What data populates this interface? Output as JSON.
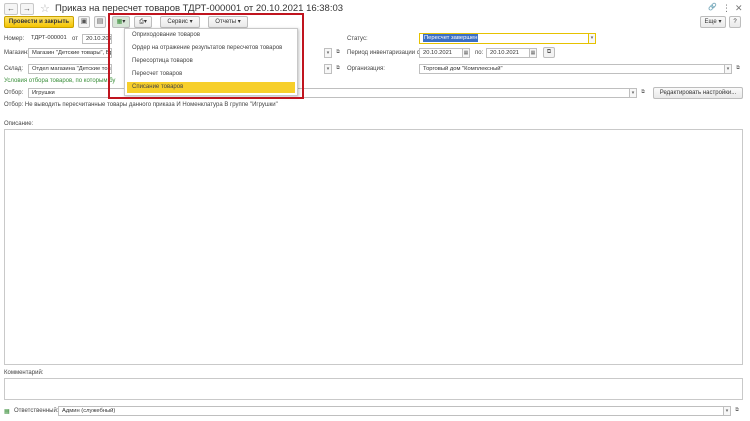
{
  "window": {
    "title": "Приказ на пересчет товаров ТДРТ-000001 от 20.10.2021 16:38:03",
    "back_glyph": "←",
    "forward_glyph": "→",
    "star_glyph": "☆",
    "link_glyph": "🔗",
    "more_glyph": "⋮",
    "close_glyph": "✕",
    "icons": [
      "back-arrow-icon",
      "forward-arrow-icon",
      "star-icon",
      "link-icon",
      "more-icon",
      "close-icon"
    ]
  },
  "toolbar": {
    "post_close_label": "Провести и закрыть",
    "service_label": "Сервис",
    "reports_label": "Отчеты",
    "more_label": "Еще",
    "help_label": "?",
    "save_glyph": "▣",
    "post_glyph": "▤",
    "create_glyph": "▦",
    "print_glyph": "⎙",
    "dd_glyph": "▾"
  },
  "create_menu": {
    "items": [
      {
        "label": "Оприходование товаров"
      },
      {
        "label": "Ордер на отражение результатов пересчетов товаров"
      },
      {
        "label": "Пересортица товаров"
      },
      {
        "label": "Пересчет товаров"
      },
      {
        "label": "Списание товаров"
      }
    ],
    "active_index": 4
  },
  "form": {
    "number_label": "Номер:",
    "number_value": "ТДРТ-000001",
    "date_from_label": "от",
    "date_value": "20.10.2021",
    "status_label": "Статус:",
    "status_value": "Пересчет завершен",
    "store_label": "Магазин:",
    "store_value": "Магазин \"Детские товары\", Бр",
    "period_label": "Период инвентаризации с:",
    "period_from": "20.10.2021",
    "period_to_label": "по:",
    "period_to": "20.10.2021",
    "warehouse_label": "Склад:",
    "warehouse_value": "Отдел магазина \"Детские това",
    "org_label": "Организация:",
    "org_value": "Торговый дом \"Комплексный\"",
    "conditions_link": "Условия отбора товаров, по которым бу",
    "filter_label": "Отбор:",
    "filter_value": "Игрушки",
    "edit_settings_label": "Редактировать настройки...",
    "filter_info": "Отбор: Не выводить пересчитанные товары данного приказа И Номенклатура В группе \"Игрушки\"",
    "description_label": "Описание:",
    "comment_label": "Комментарий:",
    "responsible_label": "Ответственный:",
    "responsible_value": "Админ (служебный)",
    "dd_glyph": "▾",
    "calendar_glyph": "▦",
    "open_glyph": "⧉",
    "clear_glyph": "✕"
  }
}
